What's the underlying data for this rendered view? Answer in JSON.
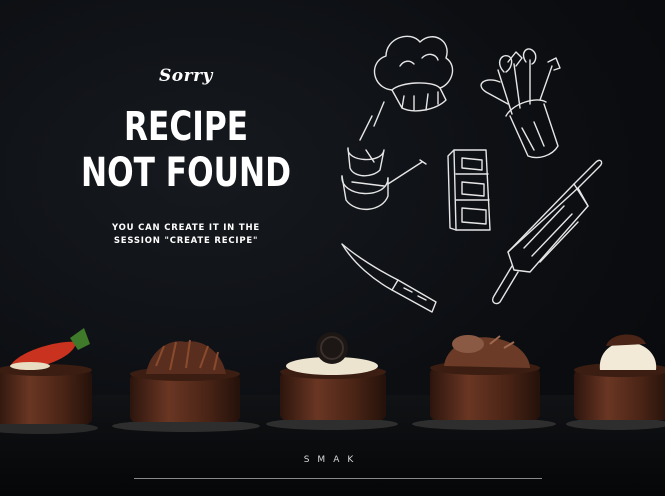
{
  "message": {
    "sorry": "Sorry",
    "headline_line1": "RECIPE",
    "headline_line2": "NOT FOUND",
    "hint_line1": "YOU CAN CREATE IT IN THE",
    "hint_line2": "SESSION \"CREATE RECIPE\""
  },
  "footer": {
    "brand": "SMAK"
  },
  "illustrations": [
    "chef-hat-icon",
    "utensils-jar-icon",
    "pots-icon",
    "butter-block-icon",
    "knife-icon",
    "rolling-pin-icon"
  ],
  "desserts": [
    "strawberry-tart",
    "chocolate-curl-tart",
    "cookie-tart",
    "mousse-tart",
    "cream-tart"
  ],
  "colors": {
    "background": "#0b0d10",
    "text": "#ffffff",
    "chocolate": "#5a2e1e",
    "strawberry": "#c8321e"
  }
}
